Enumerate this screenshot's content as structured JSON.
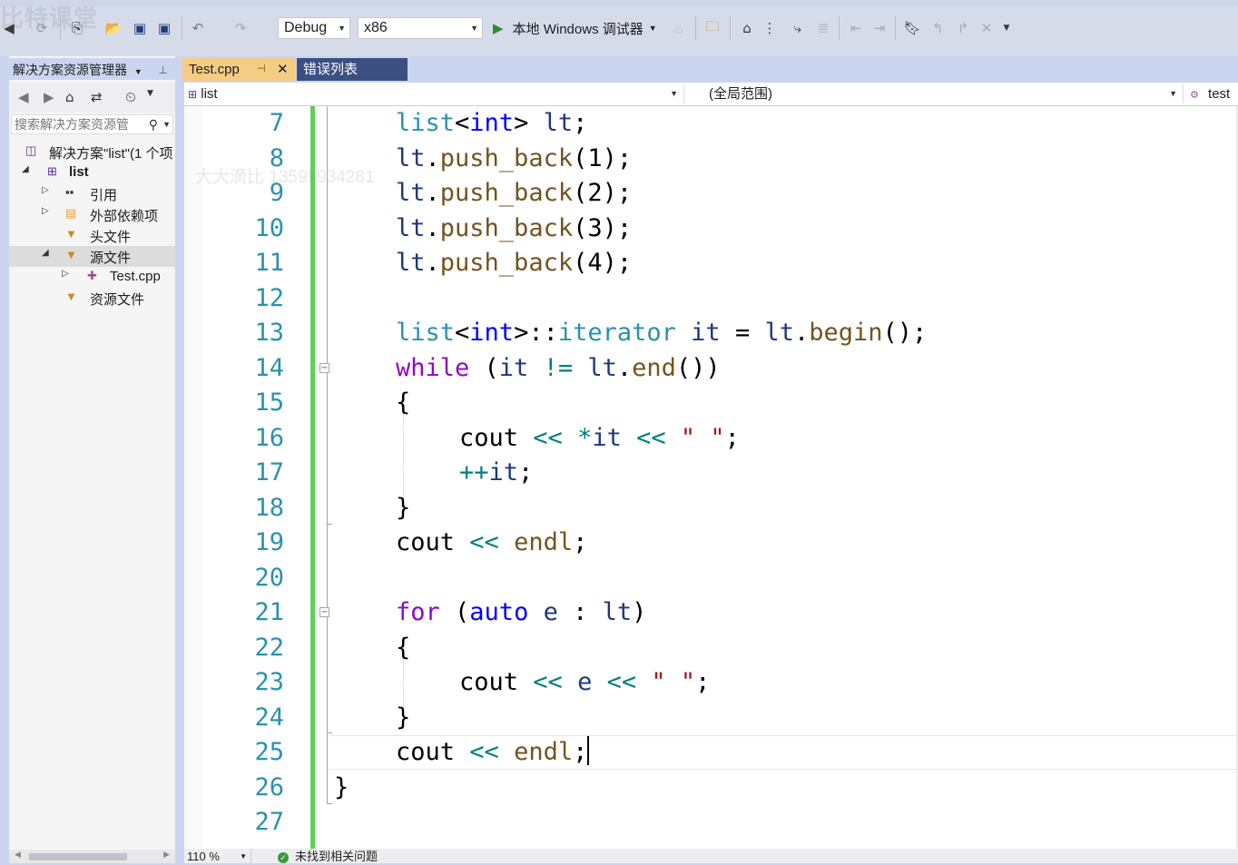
{
  "toolbar": {
    "config": "Debug",
    "platform": "x86",
    "debugger": "本地 Windows 调试器",
    "watermark": "比特课堂"
  },
  "explorer": {
    "title": "解决方案资源管理器",
    "search_placeholder": "搜索解决方案资源管",
    "tree": [
      {
        "label": "解决方案\"list\"(1 个项",
        "icon": "solution-icon"
      },
      {
        "label": "list",
        "icon": "project-icon"
      },
      {
        "label": "引用",
        "icon": "references-icon"
      },
      {
        "label": "外部依赖项",
        "icon": "external-deps-icon"
      },
      {
        "label": "头文件",
        "icon": "folder-filter-icon"
      },
      {
        "label": "源文件",
        "icon": "folder-filter-icon"
      },
      {
        "label": "Test.cpp",
        "icon": "cpp-file-icon"
      },
      {
        "label": "资源文件",
        "icon": "folder-filter-icon"
      }
    ]
  },
  "tabs": {
    "active": "Test.cpp",
    "errors": "错误列表"
  },
  "navbar": {
    "project": "list",
    "scope": "(全局范围)",
    "member": "test"
  },
  "editor": {
    "watermark": "大大滴比 13599934281",
    "line_numbers": [
      "7",
      "8",
      "9",
      "10",
      "11",
      "12",
      "13",
      "14",
      "15",
      "16",
      "17",
      "18",
      "19",
      "20",
      "21",
      "22",
      "23",
      "24",
      "25",
      "26",
      "27"
    ]
  },
  "status": {
    "zoom": "110 %",
    "issues": "未找到相关问题"
  },
  "colors": {
    "type": "#2b91af",
    "keyword": "#0000ff",
    "control": "#8f08c4",
    "variable": "#1f377f",
    "function": "#74531f",
    "operator": "#008080",
    "string": "#a31515",
    "change_bar": "#5fcf5f",
    "active_tab": "#f5cc84"
  }
}
